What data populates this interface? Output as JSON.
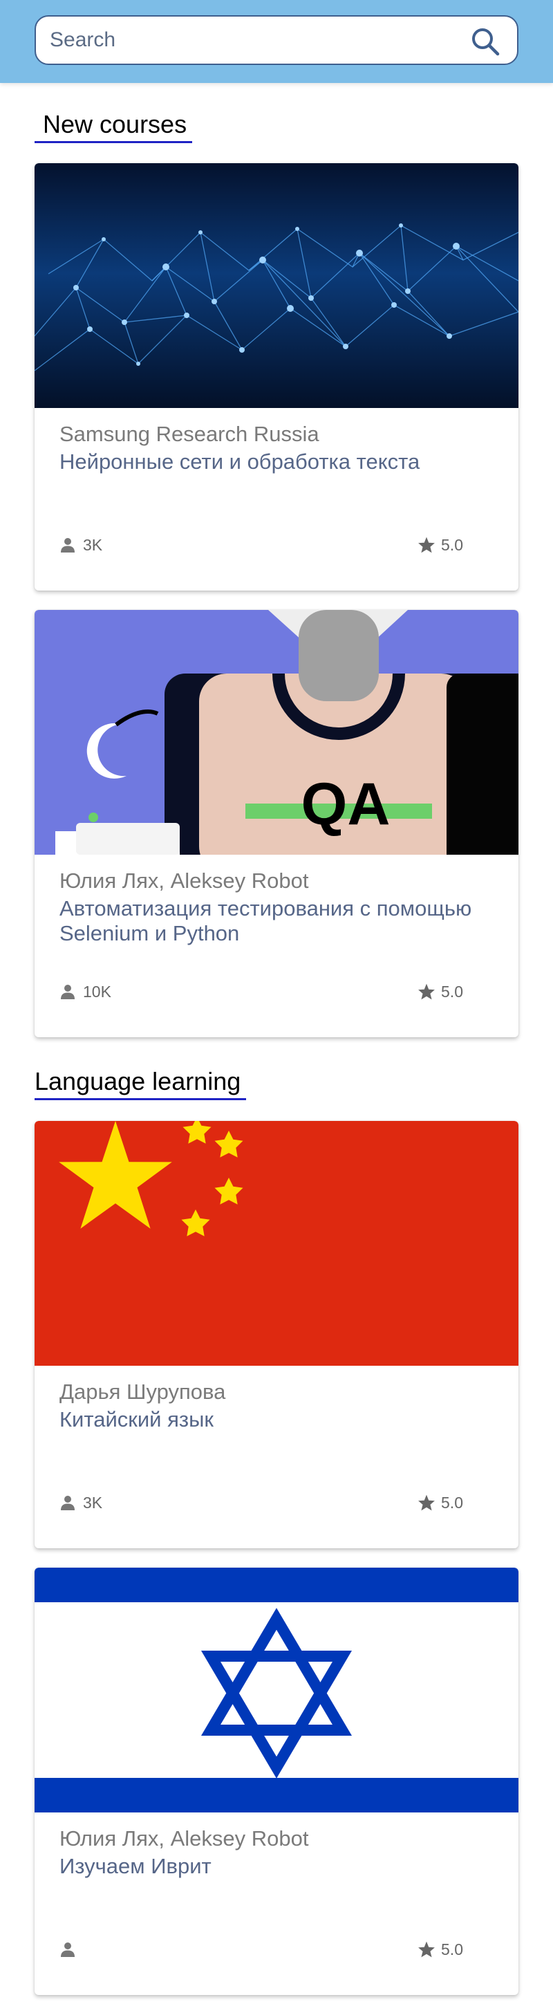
{
  "search": {
    "placeholder": "Search"
  },
  "sections": [
    {
      "title": "New courses",
      "courses": [
        {
          "author": "Samsung Research Russia",
          "title": "Нейронные сети и обработка текста",
          "learners": "3K",
          "rating": "5.0",
          "cover": "neural-network-image"
        },
        {
          "author": "Юлия Лях, Aleksey Robot",
          "title": "Автоматизация тестирования с помощью Selenium и Python",
          "learners": "10K",
          "rating": "5.0",
          "cover": "qa-illustration",
          "cover_text": "QA"
        }
      ]
    },
    {
      "title": "Language learning",
      "courses": [
        {
          "author": "Дарья Шурупова",
          "title": "Китайский язык",
          "learners": "3K",
          "rating": "5.0",
          "cover": "china-flag"
        },
        {
          "author": "Юлия Лях, Aleksey Robot",
          "title": "Изучаем Иврит",
          "learners": "",
          "rating": "5.0",
          "cover": "israel-flag"
        }
      ]
    }
  ],
  "colors": {
    "topbar": "#7dbde7",
    "search_border": "#3f5f8e",
    "section_underline": "#1f23c4",
    "course_title": "#566688",
    "author": "#7a7a7a"
  }
}
